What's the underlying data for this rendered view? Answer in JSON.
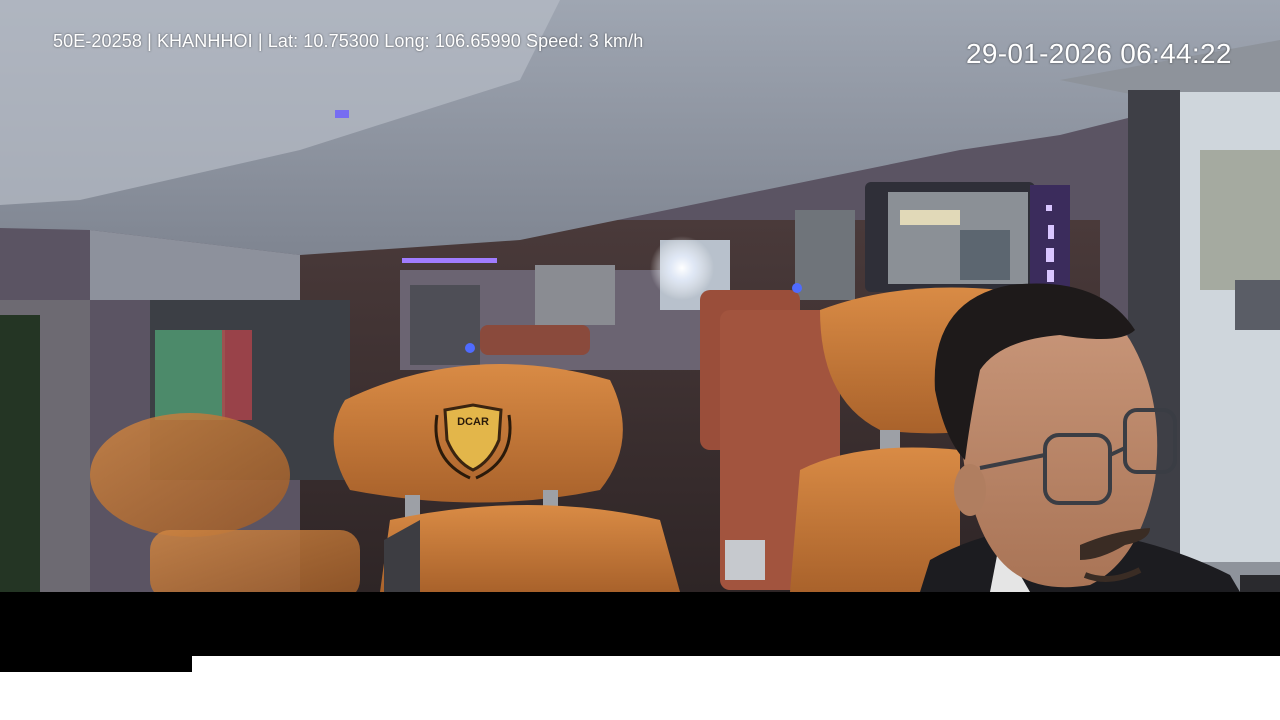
{
  "camera_feed": {
    "vehicle_info_line": "50E-20258 | KHANHHOI | Lat: 10.75300 Long: 106.65990 Speed: 3 km/h",
    "timestamp": "29-01-2026 06:44:22",
    "headrest_logo_text": "DCAR",
    "overlay_text_color": "#ffffff",
    "seat_leather_color": "#c77a3a",
    "ambient_light_color": "#8a5cff"
  }
}
